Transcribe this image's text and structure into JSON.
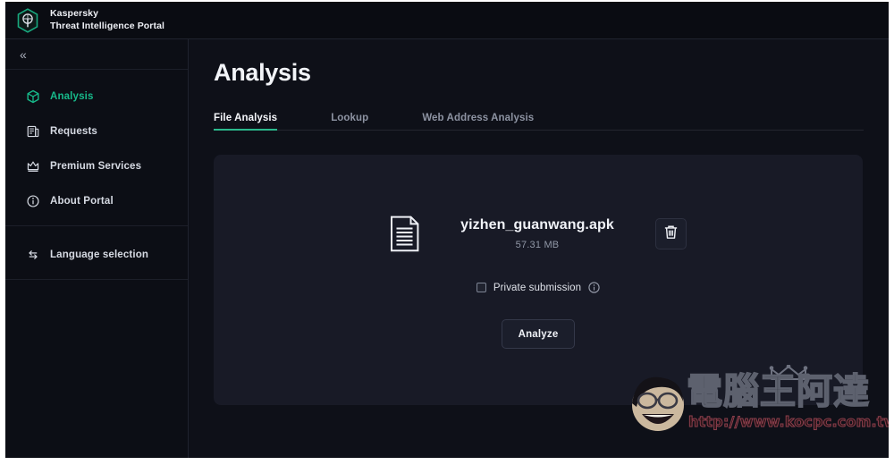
{
  "brand": {
    "name": "Kaspersky",
    "subtitle": "Threat Intelligence Portal",
    "logo_icon": "kaspersky-hex-logo-icon",
    "accent_color": "#17b98a"
  },
  "sidebar": {
    "collapse_icon": "chevron-double-left-icon",
    "items": [
      {
        "label": "Analysis",
        "icon": "cube-icon",
        "active": true
      },
      {
        "label": "Requests",
        "icon": "document-list-icon",
        "active": false
      },
      {
        "label": "Premium Services",
        "icon": "crown-icon",
        "active": false
      },
      {
        "label": "About Portal",
        "icon": "info-circle-icon",
        "active": false
      }
    ],
    "footer": {
      "label": "Language selection",
      "icon": "language-swap-icon"
    }
  },
  "main": {
    "page_title": "Analysis",
    "tabs": [
      {
        "label": "File Analysis",
        "active": true
      },
      {
        "label": "Lookup",
        "active": false
      },
      {
        "label": "Web Address Analysis",
        "active": false
      }
    ],
    "card": {
      "file_icon": "file-document-icon",
      "file_name": "yizhen_guanwang.apk",
      "file_size": "57.31 MB",
      "delete_icon": "trash-icon",
      "private_submission": {
        "label": "Private submission",
        "checked": false,
        "info_icon": "info-circle-icon"
      },
      "analyze_label": "Analyze"
    }
  },
  "watermark": {
    "title": "電腦王阿達",
    "url": "http://www.kocpc.com.tw",
    "face_icon": "cartoon-face-icon",
    "crown_icon": "crown-icon"
  }
}
